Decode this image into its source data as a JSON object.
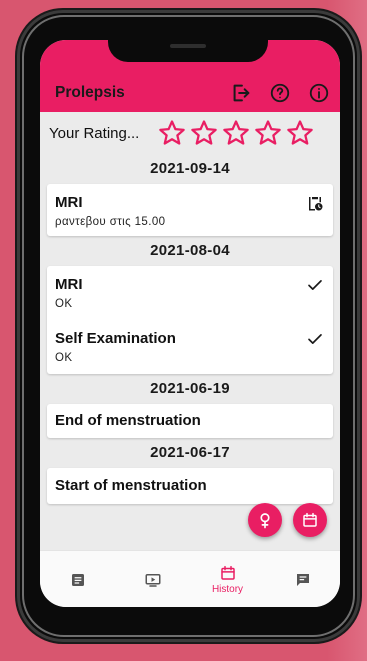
{
  "app": {
    "title": "Prolepsis"
  },
  "toolbar": {
    "icons": [
      "logout-icon",
      "help-icon",
      "info-icon"
    ]
  },
  "rating": {
    "label": "Your Rating...",
    "stars_total": 5,
    "stars_filled": 0
  },
  "history": [
    {
      "date": "2021-09-14",
      "events": [
        {
          "title": "MRI",
          "note": "ραντεβου στις 15.00",
          "status_icon": "clipboard-clock-icon"
        }
      ]
    },
    {
      "date": "2021-08-04",
      "events": [
        {
          "title": "MRI",
          "note": "OK",
          "status_icon": "check-icon"
        },
        {
          "title": "Self Examination",
          "note": "OK",
          "status_icon": "check-icon"
        }
      ]
    },
    {
      "date": "2021-06-19",
      "events": [
        {
          "title": "End of menstruation",
          "note": "",
          "status_icon": ""
        }
      ]
    },
    {
      "date": "2021-06-17",
      "events": [
        {
          "title": "Start of menstruation",
          "note": "",
          "status_icon": ""
        }
      ]
    }
  ],
  "fabs": [
    "female-symbol-icon",
    "calendar-icon"
  ],
  "bottom_nav": {
    "items": [
      {
        "icon": "article-icon",
        "label": ""
      },
      {
        "icon": "video-icon",
        "label": ""
      },
      {
        "icon": "calendar-icon",
        "label": "History",
        "active": true
      },
      {
        "icon": "chat-icon",
        "label": ""
      }
    ]
  },
  "colors": {
    "accent": "#e91e63",
    "background": "#d8566f",
    "screen": "#ebebeb",
    "card": "#ffffff"
  }
}
